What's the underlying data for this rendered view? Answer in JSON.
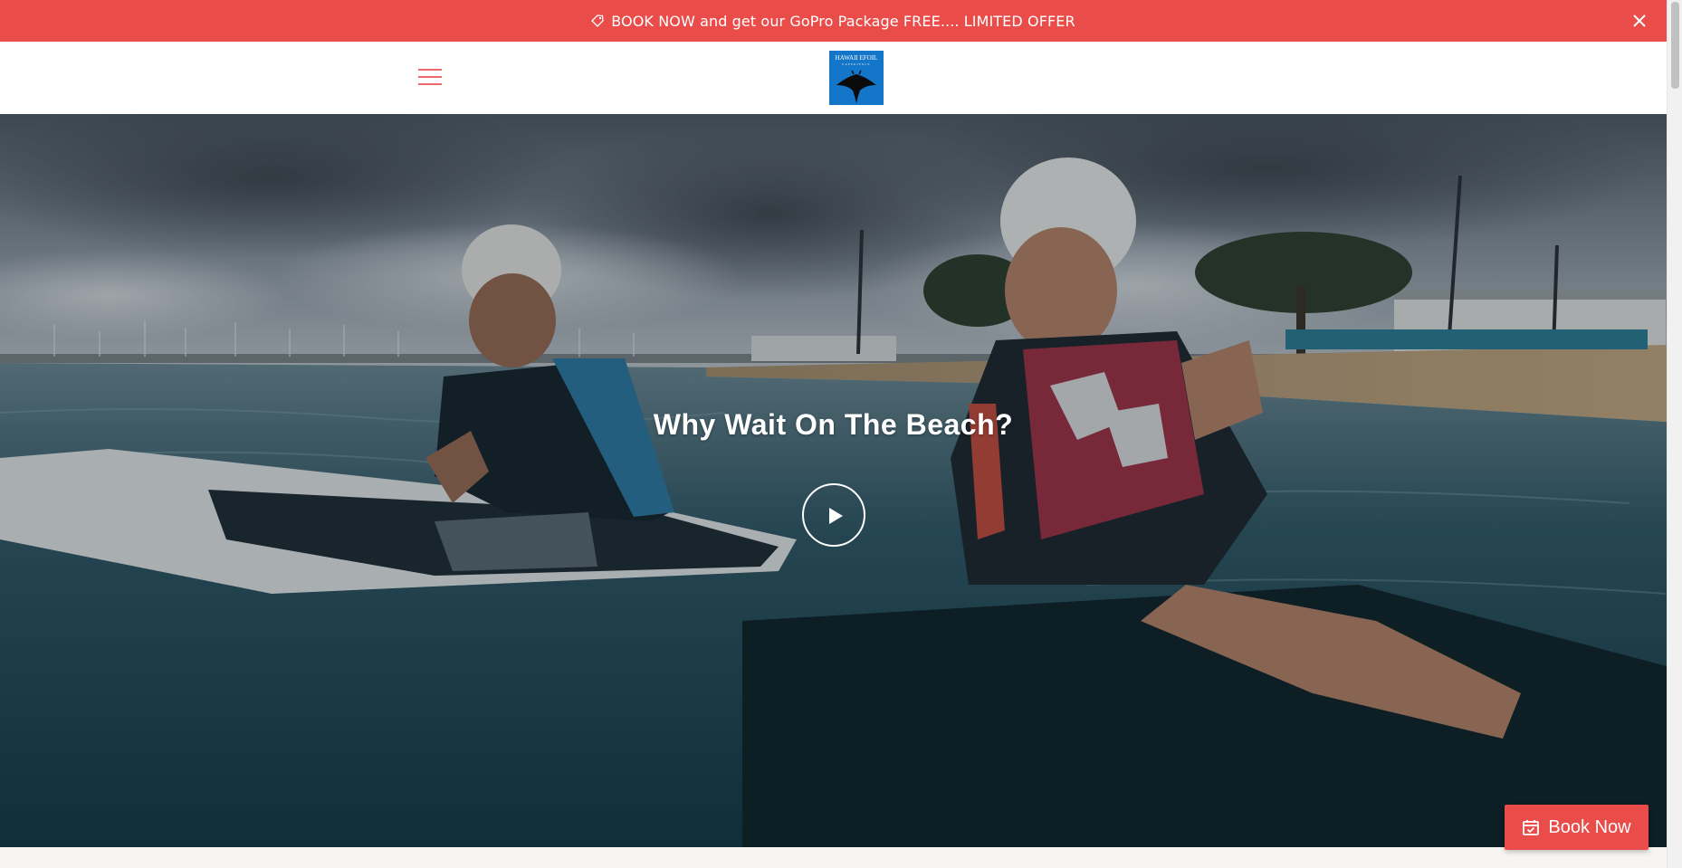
{
  "announcement": {
    "text": "BOOK NOW and get our GoPro Package FREE.... LIMITED OFFER",
    "icon": "tag-icon",
    "close_icon": "close-icon",
    "background_color": "#ea4c4a"
  },
  "header": {
    "menu_icon": "hamburger-menu-icon",
    "logo": {
      "title": "HAWAII EFOIL",
      "subtitle": "EXPERIENCE",
      "icon": "manta-ray-icon"
    }
  },
  "hero": {
    "title": "Why Wait On The Beach?",
    "play_icon": "play-icon"
  },
  "book_now": {
    "label": "Book Now",
    "icon": "calendar-check-icon",
    "color": "#ea4c4a"
  }
}
